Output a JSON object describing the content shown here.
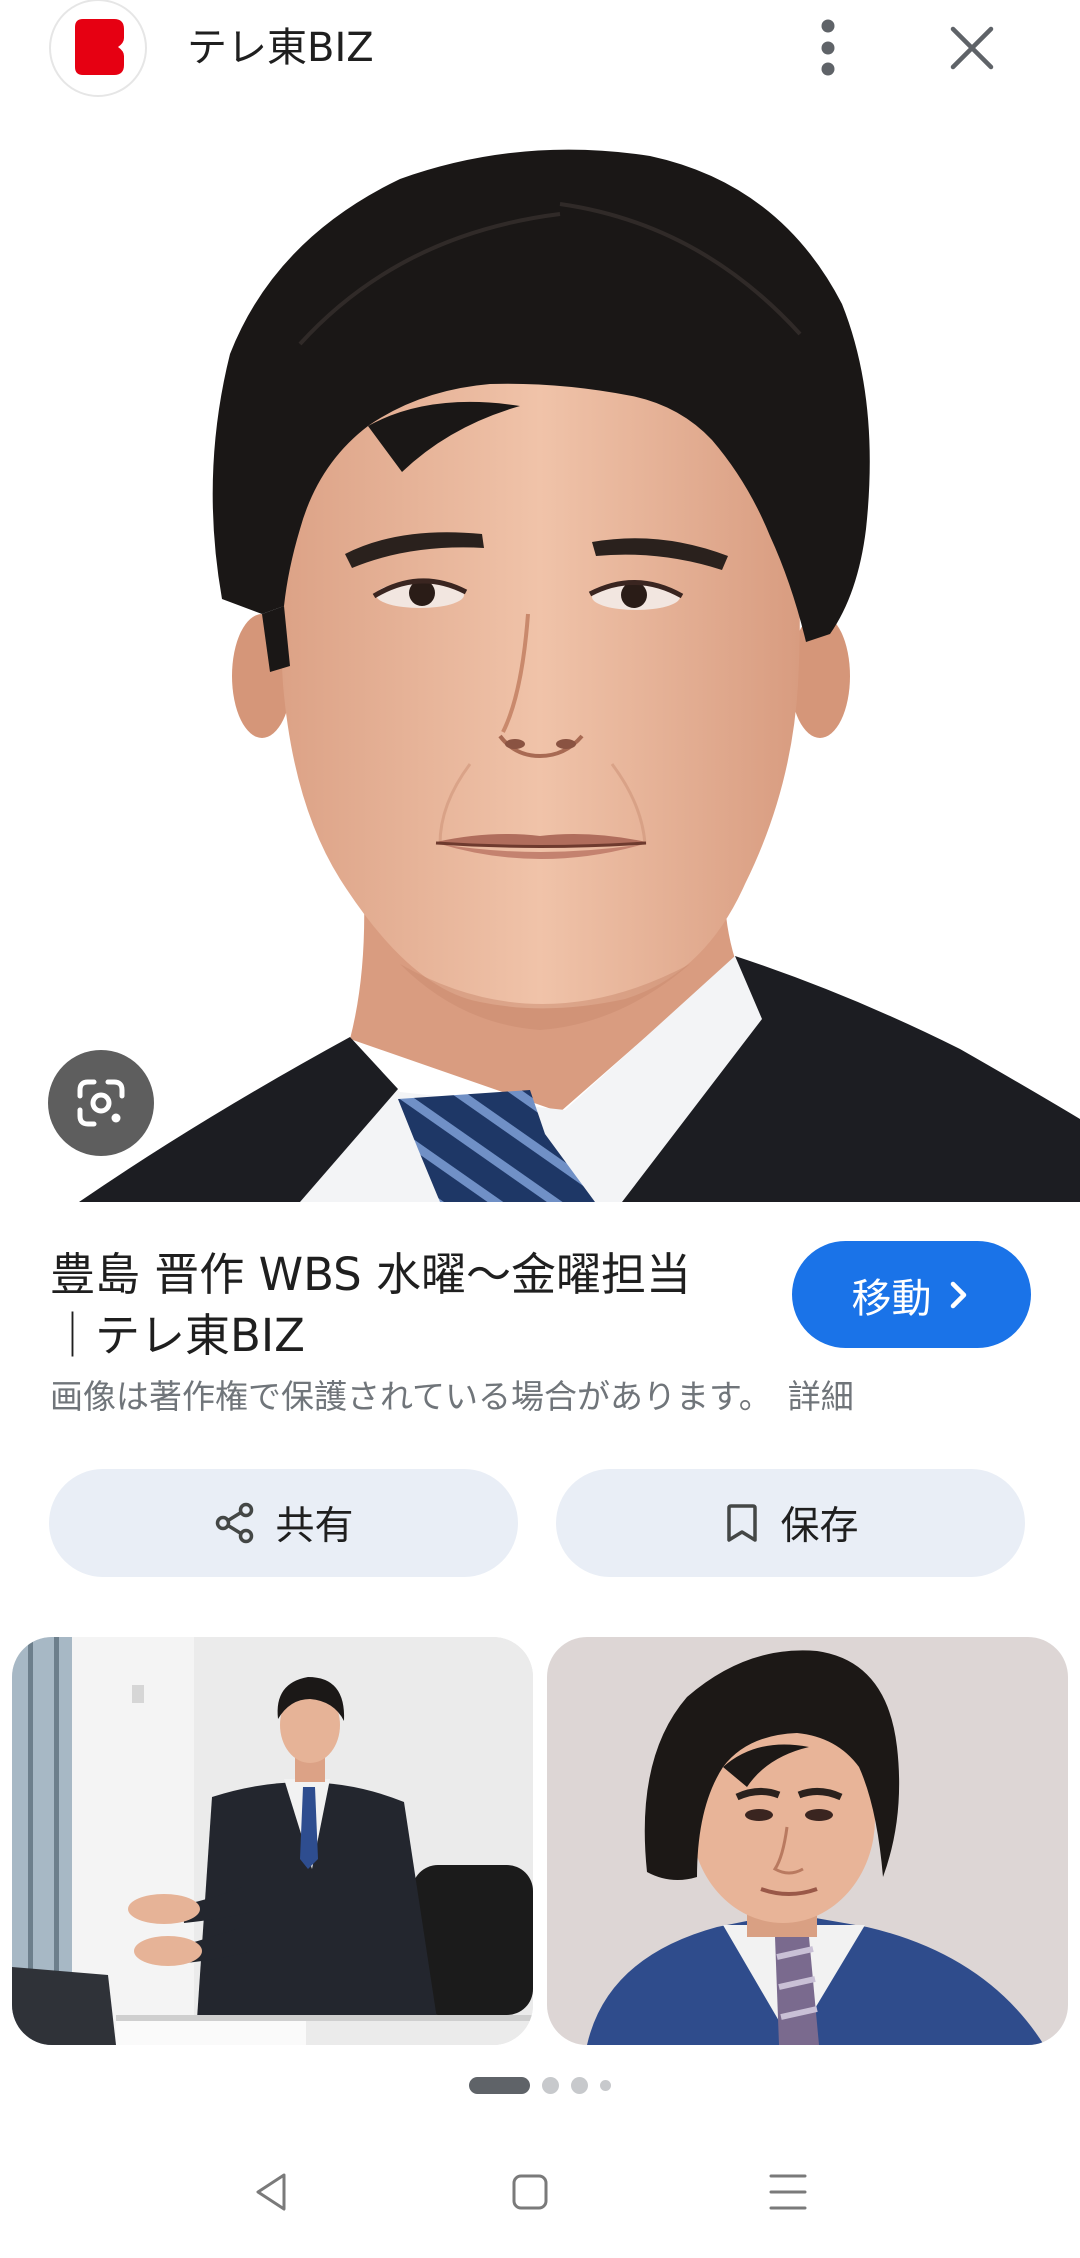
{
  "header": {
    "source_name": "テレ東BIZ",
    "logo_icon": "tv-tokyo-biz-logo",
    "menu_icon": "more-vert-icon",
    "close_icon": "close-icon"
  },
  "viewer": {
    "lens_icon": "google-lens-icon"
  },
  "result": {
    "title": "豊島 晋作 WBS 水曜～金曜担当\n｜テレ東BIZ",
    "visit_label": "移動",
    "visit_icon": "chevron-right-icon",
    "copyright_notice": "画像は著作権で保護されている場合があります。",
    "details_link": "詳細"
  },
  "actions": {
    "share": {
      "label": "共有",
      "icon": "share-icon"
    },
    "save": {
      "label": "保存",
      "icon": "bookmark-icon"
    }
  },
  "pagination": {
    "count": 4,
    "active": 0
  },
  "system_nav": {
    "back_icon": "back-icon",
    "home_icon": "home-icon",
    "recents_icon": "recents-icon"
  },
  "colors": {
    "accent": "#1a73e8",
    "action_bg": "#e9eef6",
    "text": "#1f1f1f",
    "muted": "#70757a",
    "brand_red": "#e60012"
  }
}
